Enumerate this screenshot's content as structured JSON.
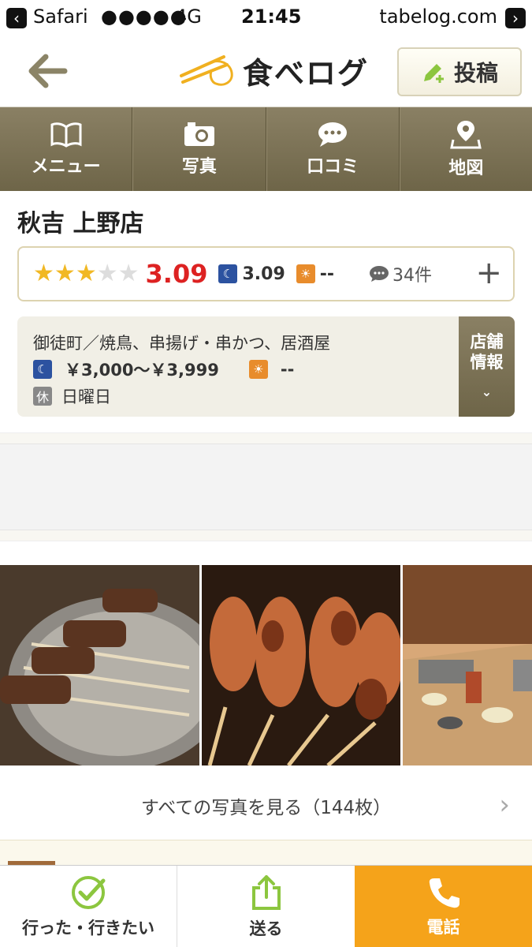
{
  "status_bar": {
    "carrier": "Safari",
    "signal": "●●●●●",
    "network": "4G",
    "time": "21:45",
    "domain": "tabelog.com"
  },
  "header": {
    "logo_text": "食べログ",
    "post_label": "投稿",
    "accent_color": "#8b8467"
  },
  "tabs": [
    {
      "label": "メニュー",
      "icon": "book-icon"
    },
    {
      "label": "写真",
      "icon": "camera-icon"
    },
    {
      "label": "口コミ",
      "icon": "speech-bubble-icon"
    },
    {
      "label": "地図",
      "icon": "map-pin-icon"
    }
  ],
  "restaurant": {
    "name": "秋吉 上野店",
    "stars_filled": 3,
    "stars_total": 5,
    "score": "3.09",
    "night_score": "3.09",
    "day_score": "--",
    "review_count": "34件",
    "category": "御徒町／焼鳥、串揚げ・串かつ、居酒屋",
    "night_budget": "￥3,000～￥3,999",
    "day_budget": "--",
    "holiday_badge": "休",
    "holiday": "日曜日",
    "info_button": "店舗\n情報"
  },
  "photos": {
    "see_all": "すべての写真を見る（144枚）"
  },
  "bottom_bar": {
    "went_label": "行った・行きたい",
    "send_label": "送る",
    "call_label": "電話",
    "call_color": "#f5a31a"
  }
}
